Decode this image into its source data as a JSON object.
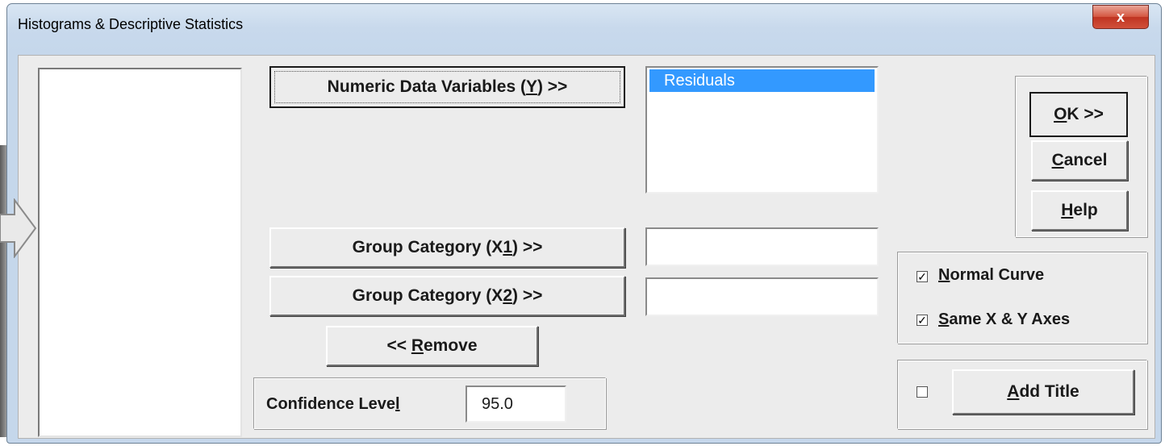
{
  "window": {
    "title": "Histograms & Descriptive Statistics",
    "close_glyph": "x"
  },
  "variables": {
    "numeric_button": {
      "pre": "Numeric Data Variables (",
      "key": "Y",
      "post": ") >>"
    },
    "selected_list": [
      "Residuals"
    ],
    "group1_button": {
      "pre": "Group Category (X",
      "key": "1",
      "post": ") >>"
    },
    "group1_value": "",
    "group2_button": {
      "pre": "Group Category (X",
      "key": "2",
      "post": ") >>"
    },
    "group2_value": "",
    "remove_button": {
      "pre": "<< ",
      "key": "R",
      "post": "emove"
    }
  },
  "confidence": {
    "label_pre": "Confidence Leve",
    "label_key": "l",
    "value": "95.0"
  },
  "actions": {
    "ok": {
      "key": "O",
      "post": "K >>"
    },
    "cancel": {
      "key": "C",
      "post": "ancel"
    },
    "help": {
      "key": "H",
      "post": "elp"
    }
  },
  "options": {
    "normal_curve": {
      "key": "N",
      "post": "ormal Curve",
      "checked": true
    },
    "same_axes": {
      "key": "S",
      "post": "ame X & Y Axes",
      "checked": true
    },
    "add_title": {
      "key": "A",
      "post": "dd Title",
      "checked": false
    }
  },
  "colors": {
    "selection": "#3399ff",
    "close_button": "#c8412c",
    "dialog_face": "#ececec"
  },
  "icons": {
    "pointer_arrow": "arrow-right-icon",
    "close": "close-icon",
    "check": "checkmark-icon"
  }
}
